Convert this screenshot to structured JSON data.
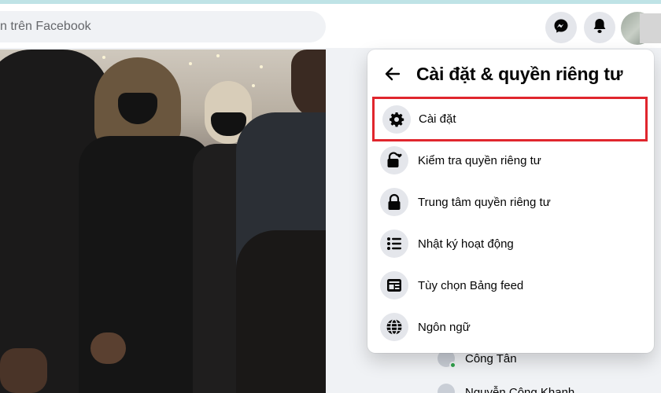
{
  "topbar": {
    "search_placeholder": "n trên Facebook",
    "messenger_icon": "messenger-icon",
    "notification_icon": "bell-icon"
  },
  "menu": {
    "title": "Cài đặt & quyền riêng tư",
    "items": [
      {
        "label": "Cài đặt",
        "icon": "gear-icon",
        "highlighted": true
      },
      {
        "label": "Kiểm tra quyền riêng tư",
        "icon": "lock-heart-icon"
      },
      {
        "label": "Trung tâm quyền riêng tư",
        "icon": "lock-icon"
      },
      {
        "label": "Nhật ký hoạt động",
        "icon": "list-icon"
      },
      {
        "label": "Tùy chọn Bảng feed",
        "icon": "feed-icon"
      },
      {
        "label": "Ngôn ngữ",
        "icon": "globe-icon"
      }
    ]
  },
  "contacts": [
    {
      "name": "Công Tân"
    },
    {
      "name": "Nguyễn Công Khanh"
    }
  ],
  "colors": {
    "highlight_border": "#e0262d",
    "icon_circle": "#e4e6eb",
    "background": "#f0f2f5"
  }
}
